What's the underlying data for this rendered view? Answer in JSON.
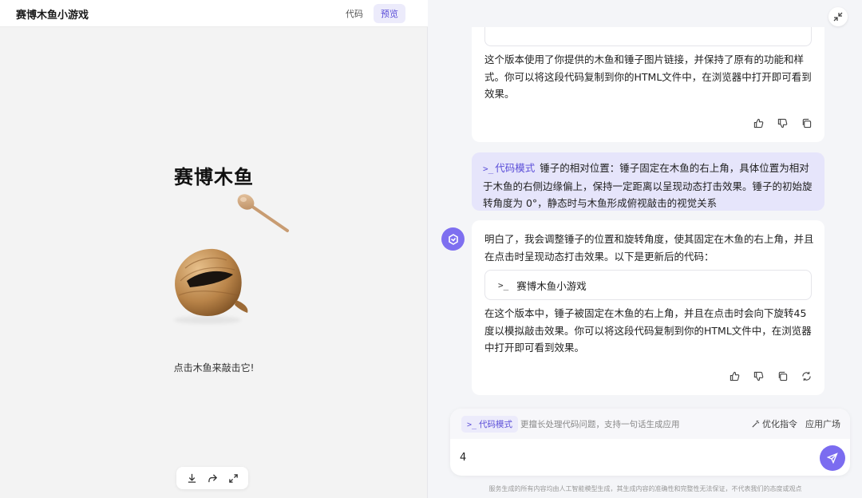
{
  "preview": {
    "app_title": "赛博木鱼小游戏",
    "tabs": [
      {
        "label": "代码",
        "active": false
      },
      {
        "label": "预览",
        "active": true
      }
    ],
    "game_title": "赛博木鱼",
    "hint": "点击木鱼来敲击它!",
    "tools": [
      "download-icon",
      "share-icon",
      "fullscreen-icon"
    ]
  },
  "chat": {
    "messages": [
      {
        "role": "assistant",
        "text": "这个版本使用了你提供的木鱼和锤子图片链接，并保持了原有的功能和样式。你可以将这段代码复制到你的HTML文件中，在浏览器中打开即可看到效果。",
        "actions": [
          "thumbs-up-icon",
          "thumbs-down-icon",
          "copy-icon"
        ]
      },
      {
        "role": "user",
        "mode_tag": "代码模式",
        "mode_symbol": ">_",
        "text": "锤子的相对位置：锤子固定在木鱼的右上角，具体位置为相对于木鱼的右侧边缘偏上，保持一定距离以呈现动态打击效果。锤子的初始旋转角度为 0°，静态时与木鱼形成俯视敲击的视觉关系"
      },
      {
        "role": "assistant",
        "text_before": "明白了，我会调整锤子的位置和旋转角度，使其固定在木鱼的右上角，并且在点击时呈现动态打击效果。以下是更新后的代码：",
        "code_symbol": ">_",
        "code_title": "赛博木鱼小游戏",
        "text_after": "在这个版本中，锤子被固定在木鱼的右上角，并且在点击时会向下旋转45度以模拟敲击效果。你可以将这段代码复制到你的HTML文件中，在浏览器中打开即可看到效果。",
        "actions": [
          "thumbs-up-icon",
          "thumbs-down-icon",
          "copy-icon",
          "regenerate-icon"
        ]
      }
    ],
    "input": {
      "mode_symbol": ">_",
      "mode_label": "代码模式",
      "mode_description": "更擅长处理代码问题，支持一句话生成应用",
      "optimize_label": "优化指令",
      "app_store_label": "应用广场",
      "value": "4"
    },
    "disclaimer": "服务生成的所有内容均由人工智能模型生成，其生成内容的准确性和完整性无法保证，不代表我们的态度或观点"
  },
  "colors": {
    "accent": "#7b6cf0",
    "accent_text": "#5b4ed8",
    "user_bubble": "#e6e5fb"
  }
}
